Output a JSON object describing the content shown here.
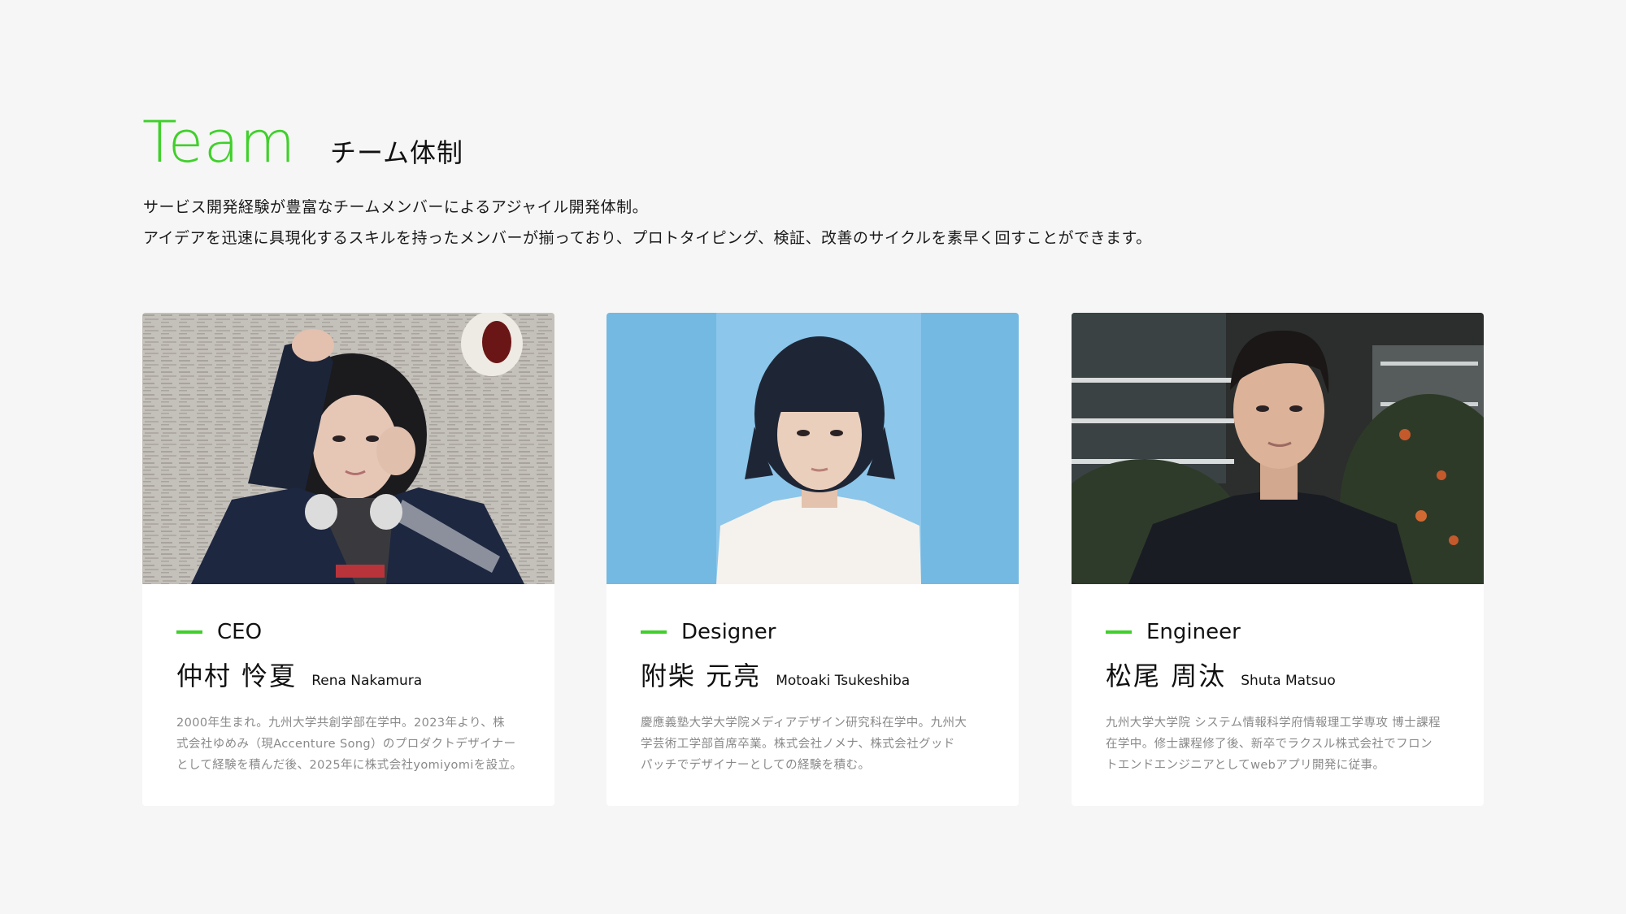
{
  "header": {
    "title_en": "Team",
    "title_ja": "チーム体制"
  },
  "intro": {
    "line1": "サービス開発経験が豊富なチームメンバーによるアジャイル開発体制。",
    "line2": "アイデアを迅速に具現化するスキルを持ったメンバーが揃っており、プロトタイピング、検証、改善のサイクルを素早く回すことができます。"
  },
  "colors": {
    "accent": "#3fd02a",
    "background": "#f6f6f6",
    "card": "#ffffff",
    "muted_text": "#8a8a8a"
  },
  "members": [
    {
      "role": "CEO",
      "name_ja": "仲村 怜夏",
      "name_en": "Rena Nakamura",
      "bio": [
        "2000年生まれ。九州大学共創学部在学中。2023年より、株",
        "式会社ゆめみ（現Accenture Song）のプロダクトデザイナー",
        "として経験を積んだ後、2025年に株式会社yomiyomiを設立。"
      ]
    },
    {
      "role": "Designer",
      "name_ja": "附柴 元亮",
      "name_en": "Motoaki Tsukeshiba",
      "bio": [
        "慶應義塾大学大学院メディアデザイン研究科在学中。九州大",
        "学芸術工学部首席卒業。株式会社ノメナ、株式会社グッド",
        "パッチでデザイナーとしての経験を積む。"
      ]
    },
    {
      "role": "Engineer",
      "name_ja": "松尾 周汰",
      "name_en": "Shuta Matsuo",
      "bio": [
        "九州大学大学院 システム情報科学府情報理工学専攻 博士課程",
        "在学中。修士課程修了後、新卒でラクスル株式会社でフロン",
        "トエンドエンジニアとしてwebアプリ開発に従事。"
      ]
    }
  ]
}
